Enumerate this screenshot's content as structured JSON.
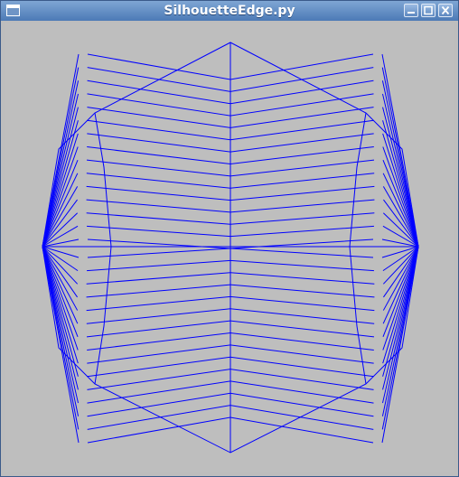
{
  "window": {
    "title": "SilhouetteEdge.py",
    "buttons": [
      "minimize",
      "maximize",
      "close"
    ]
  },
  "render": {
    "background_color": "#bebebe",
    "edge_color": "#0000ff",
    "description_icon": "window-menu-icon"
  }
}
